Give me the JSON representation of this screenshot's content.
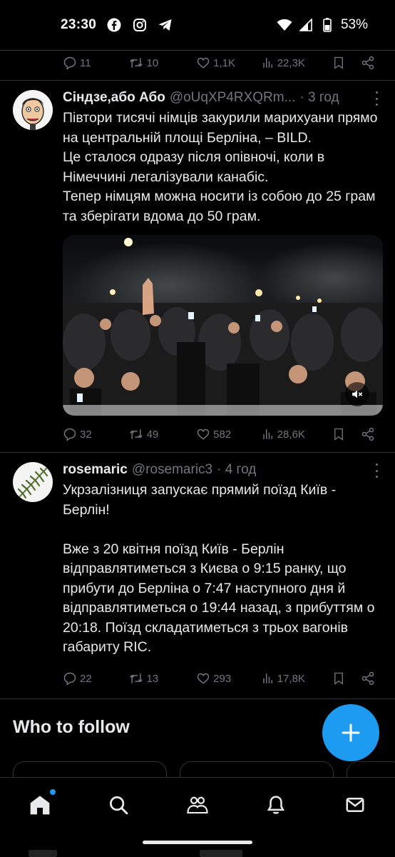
{
  "status_bar": {
    "time": "23:30",
    "apps": [
      "facebook-icon",
      "instagram-icon",
      "telegram-icon"
    ],
    "battery": "53%"
  },
  "top_actions": {
    "replies": "11",
    "retweets": "10",
    "likes": "1,1K",
    "views": "22,3K"
  },
  "tweets": [
    {
      "name": "Сіндзе,або Або",
      "handle": "@oUqXP4RXQRm...",
      "time": "· 3 год",
      "text": "Півтори тисячі німців закурили марихуани прямо на центральній площі Берліна, – BILD.\nЦе сталося одразу після опівночі, коли в Німеччині легалізували канабіс.\n Тепер німцям можна носити із собою до 25 грам та зберігати вдома до 50 грам.",
      "media": "video",
      "replies": "32",
      "retweets": "49",
      "likes": "582",
      "views": "28,6K"
    },
    {
      "name": "rosemaric",
      "handle": "@rosemaric3",
      "time": "· 4 год",
      "text": "Укрзалізниця запускає прямий поїзд Київ - Берлін!\n\nВже з 20 квітня поїзд Київ - Берлін відправлятиметься з Києва о 9:15 ранку, що прибути до Берліна о 7:47 наступного дня й відправлятиметься о 19:44 назад, з прибуттям о 20:18. Поїзд складатиметься з трьох вагонів габариту RIC.",
      "replies": "22",
      "retweets": "13",
      "likes": "293",
      "views": "17,8K"
    }
  ],
  "who_to_follow": {
    "title": "Who to follow"
  },
  "bottom_nav": [
    "home-icon",
    "search-icon",
    "communities-icon",
    "notifications-icon",
    "messages-icon"
  ],
  "colors": {
    "accent": "#1d9bf0",
    "muted": "#71767b",
    "text": "#e7e9ea",
    "background": "#000000",
    "divider": "#2f3336"
  }
}
